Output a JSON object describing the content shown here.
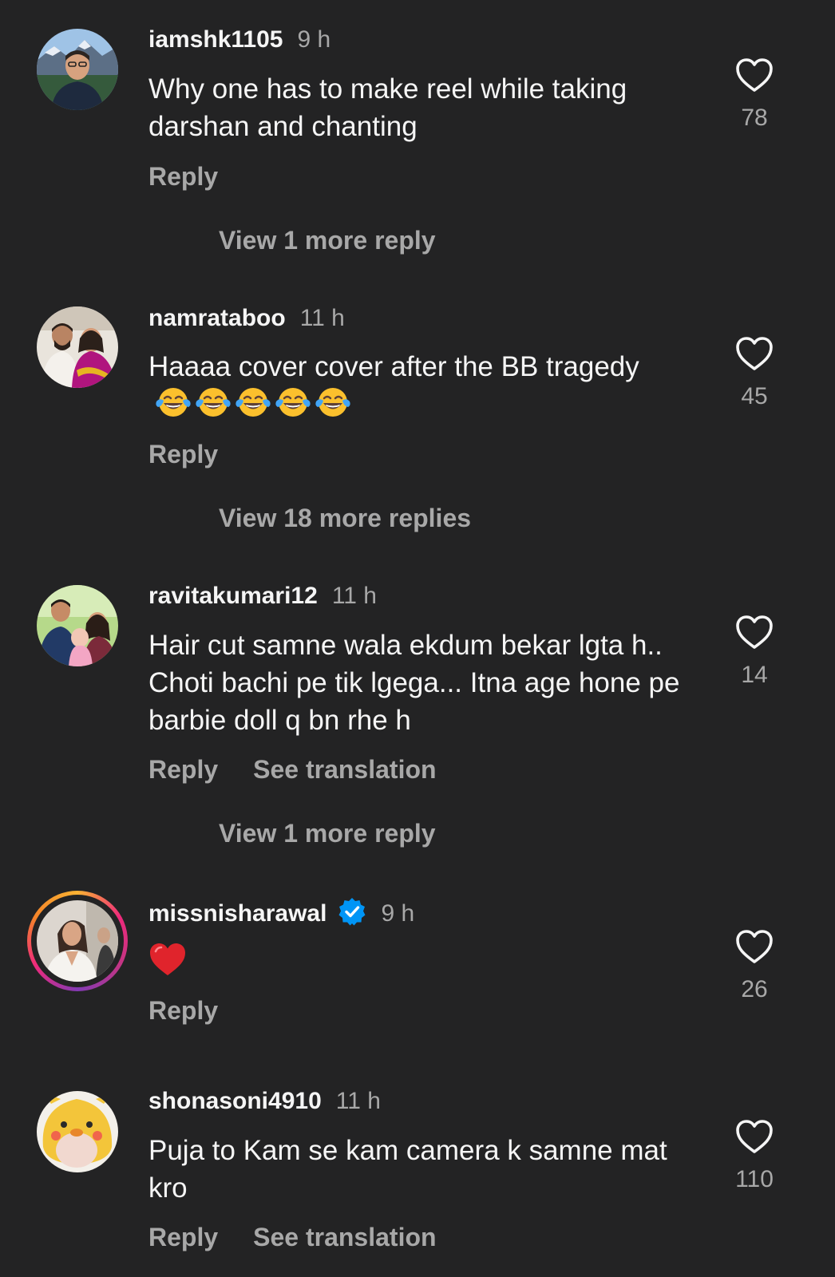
{
  "colors": {
    "background": "#232324",
    "primary_text": "#f5f5f5",
    "secondary_text": "#a8a8a8",
    "verified_blue": "#0095f6",
    "heart_red": "#e0242c"
  },
  "comments": [
    {
      "username": "iamshk1105",
      "time": "9 h",
      "text": "Why one has to make reel while taking darshan and chanting",
      "reply_label": "Reply",
      "like_count": "78",
      "view_replies": "View 1 more reply"
    },
    {
      "username": "namrataboo",
      "time": "11 h",
      "text": "Haaaa cover cover after the BB tragedy",
      "emoji": [
        "face-with-tears-of-joy",
        "face-with-tears-of-joy",
        "face-with-tears-of-joy",
        "face-with-tears-of-joy",
        "face-with-tears-of-joy"
      ],
      "reply_label": "Reply",
      "like_count": "45",
      "view_replies": "View 18 more replies"
    },
    {
      "username": "ravitakumari12",
      "time": "11 h",
      "text": "Hair cut samne wala ekdum bekar lgta h.. Choti bachi pe tik lgega... Itna age hone pe barbie doll q bn rhe h",
      "reply_label": "Reply",
      "see_translation_label": "See translation",
      "like_count": "14",
      "view_replies": "View 1 more reply"
    },
    {
      "username": "missnisharawal",
      "verified": true,
      "time": "9 h",
      "emoji": [
        "red-heart"
      ],
      "reply_label": "Reply",
      "like_count": "26"
    },
    {
      "username": "shonasoni4910",
      "time": "11 h",
      "text": "Puja to Kam se kam camera k samne mat kro",
      "reply_label": "Reply",
      "see_translation_label": "See translation",
      "like_count": "110"
    }
  ],
  "icons": {
    "like": "heart-outline-icon",
    "verified": "verified-badge-icon"
  }
}
